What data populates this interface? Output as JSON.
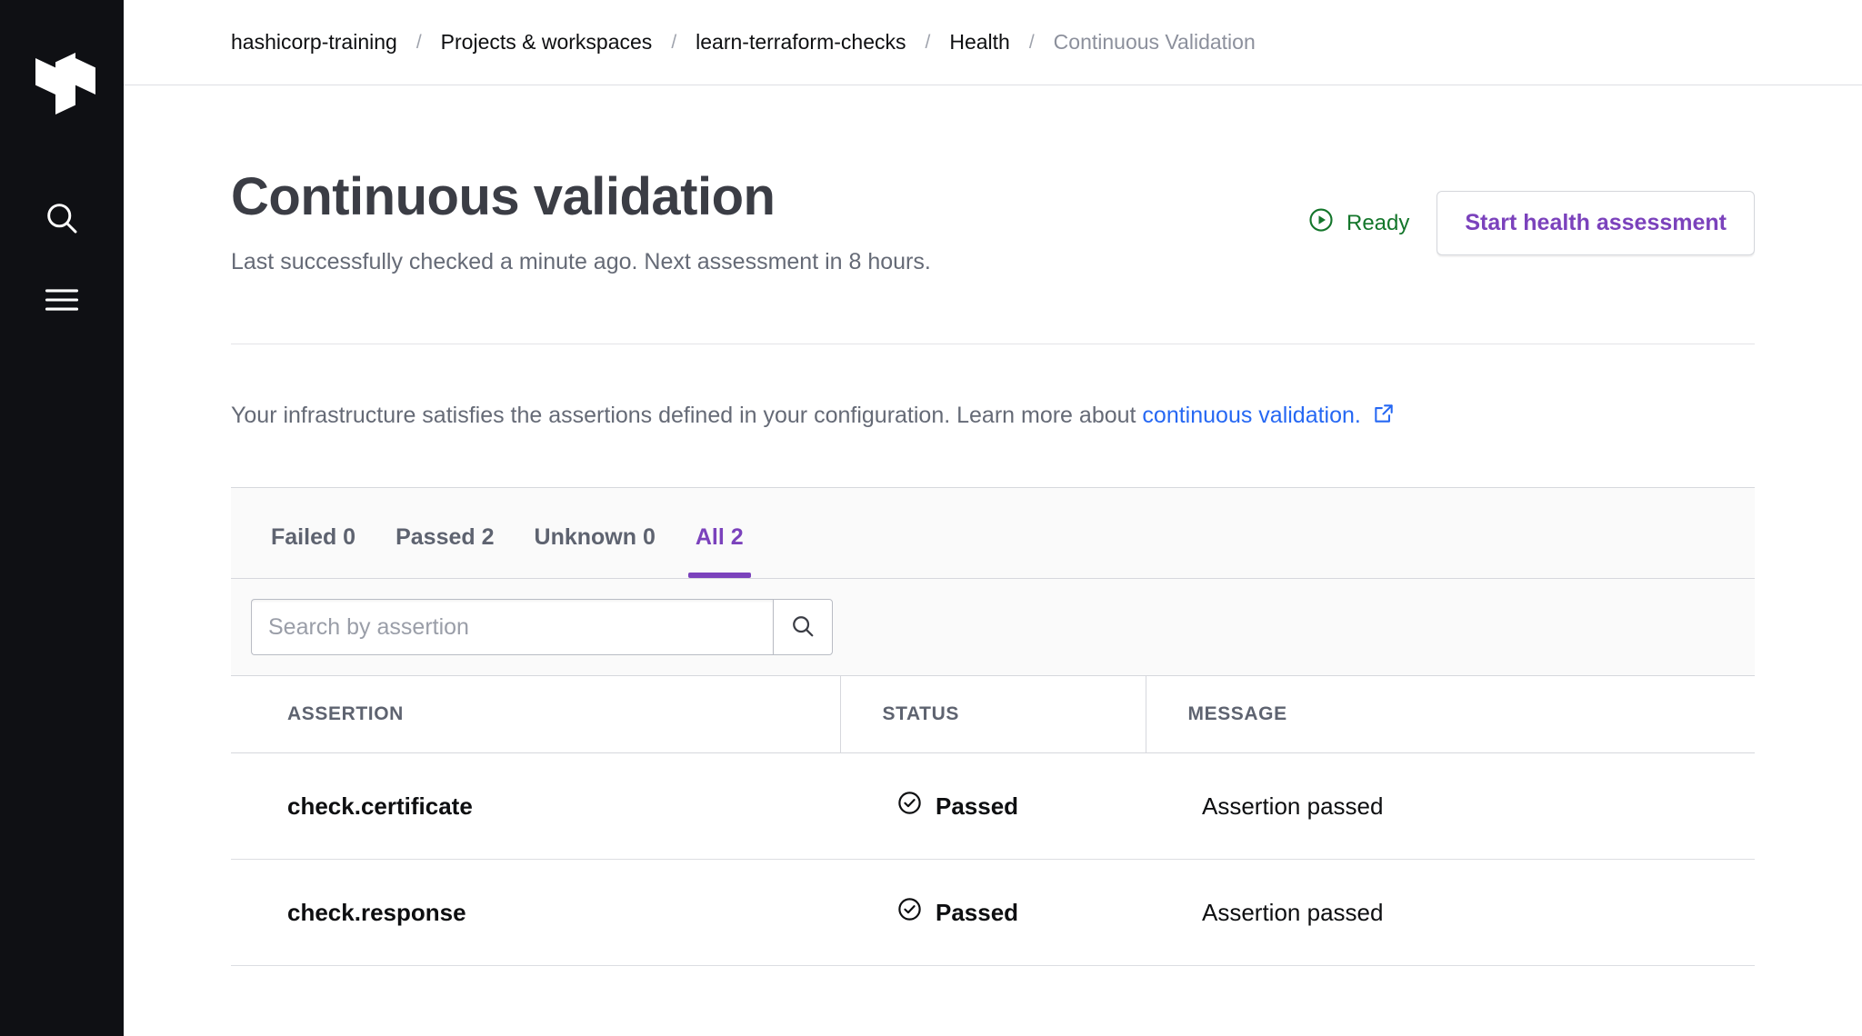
{
  "sidebar": {
    "logo_name": "terraform-logo",
    "items": [
      {
        "icon": "search-icon",
        "label": "Search"
      },
      {
        "icon": "menu-icon",
        "label": "Menu"
      }
    ]
  },
  "breadcrumb": {
    "separator": "/",
    "items": [
      {
        "label": "hashicorp-training",
        "current": false
      },
      {
        "label": "Projects & workspaces",
        "current": false
      },
      {
        "label": "learn-terraform-checks",
        "current": false
      },
      {
        "label": "Health",
        "current": false
      },
      {
        "label": "Continuous Validation",
        "current": true
      }
    ]
  },
  "header": {
    "title": "Continuous validation",
    "subtitle": "Last successfully checked a minute ago. Next assessment in 8 hours.",
    "status": {
      "label": "Ready",
      "icon": "play-circle-icon",
      "color": "#14762b"
    },
    "action_button": {
      "label": "Start health assessment",
      "color": "#7b42bc"
    }
  },
  "info": {
    "text_before": "Your infrastructure satisfies the assertions defined in your configuration. Learn more about ",
    "link_label": "continuous validation.",
    "link_color": "#2668f3",
    "external_icon": "external-link-icon"
  },
  "tabs": [
    {
      "label": "Failed 0",
      "active": false
    },
    {
      "label": "Passed 2",
      "active": false
    },
    {
      "label": "Unknown 0",
      "active": false
    },
    {
      "label": "All 2",
      "active": true
    }
  ],
  "search": {
    "placeholder": "Search by assertion",
    "value": "",
    "button_icon": "search-icon"
  },
  "table": {
    "columns": [
      "ASSERTION",
      "STATUS",
      "MESSAGE"
    ],
    "rows": [
      {
        "assertion": "check.certificate",
        "status": "Passed",
        "status_icon": "check-circle-icon",
        "message": "Assertion passed"
      },
      {
        "assertion": "check.response",
        "status": "Passed",
        "status_icon": "check-circle-icon",
        "message": "Assertion passed"
      }
    ]
  },
  "theme": {
    "sidebar_bg": "#0f1014",
    "accent": "#7b42bc",
    "link": "#2668f3",
    "success": "#14762b"
  }
}
